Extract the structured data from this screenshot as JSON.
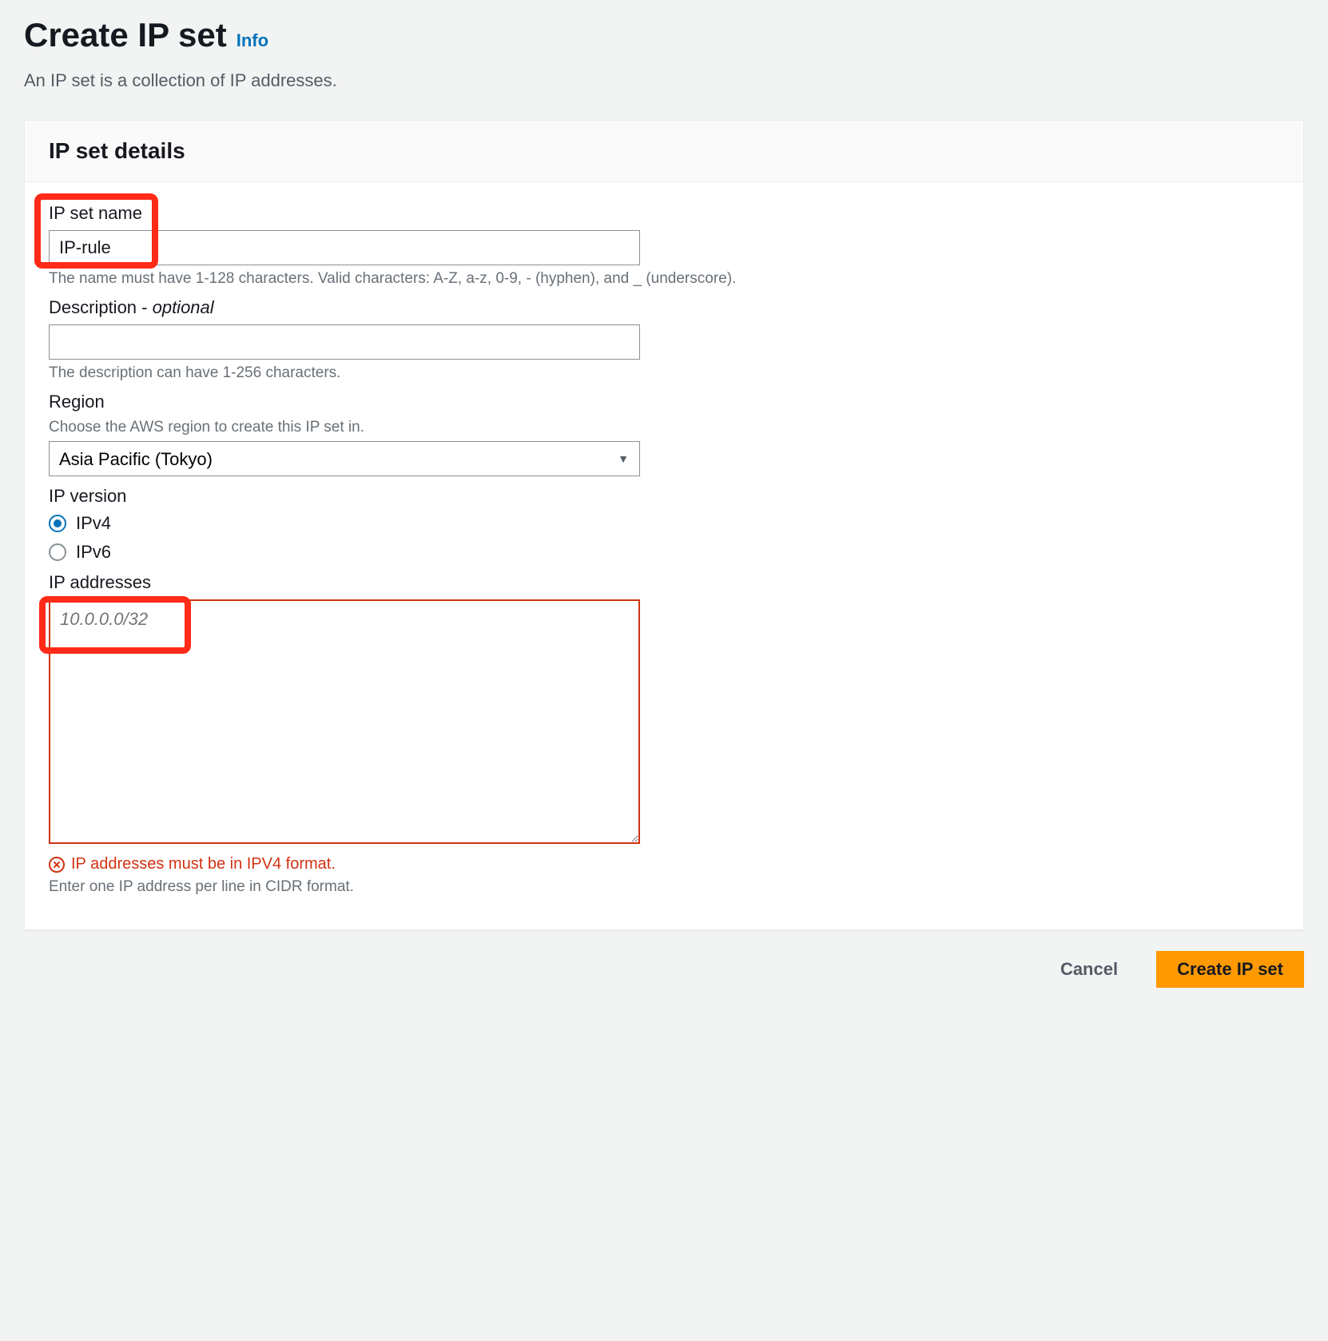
{
  "header": {
    "title": "Create IP set",
    "info_label": "Info",
    "subtitle": "An IP set is a collection of IP addresses."
  },
  "panel": {
    "title": "IP set details",
    "name": {
      "label": "IP set name",
      "value": "IP-rule",
      "hint": "The name must have 1-128 characters. Valid characters: A-Z, a-z, 0-9, - (hyphen), and _ (underscore)."
    },
    "description": {
      "label_text": "Description - ",
      "label_optional": "optional",
      "value": "",
      "hint": "The description can have 1-256 characters."
    },
    "region": {
      "label": "Region",
      "hint": "Choose the AWS region to create this IP set in.",
      "value": "Asia Pacific (Tokyo)"
    },
    "ip_version": {
      "label": "IP version",
      "options": [
        {
          "label": "IPv4",
          "checked": true
        },
        {
          "label": "IPv6",
          "checked": false
        }
      ]
    },
    "ip_addresses": {
      "label": "IP addresses",
      "placeholder": "10.0.0.0/32",
      "error": "IP addresses must be in IPV4 format.",
      "hint": "Enter one IP address per line in CIDR format."
    }
  },
  "footer": {
    "cancel": "Cancel",
    "create": "Create IP set"
  }
}
